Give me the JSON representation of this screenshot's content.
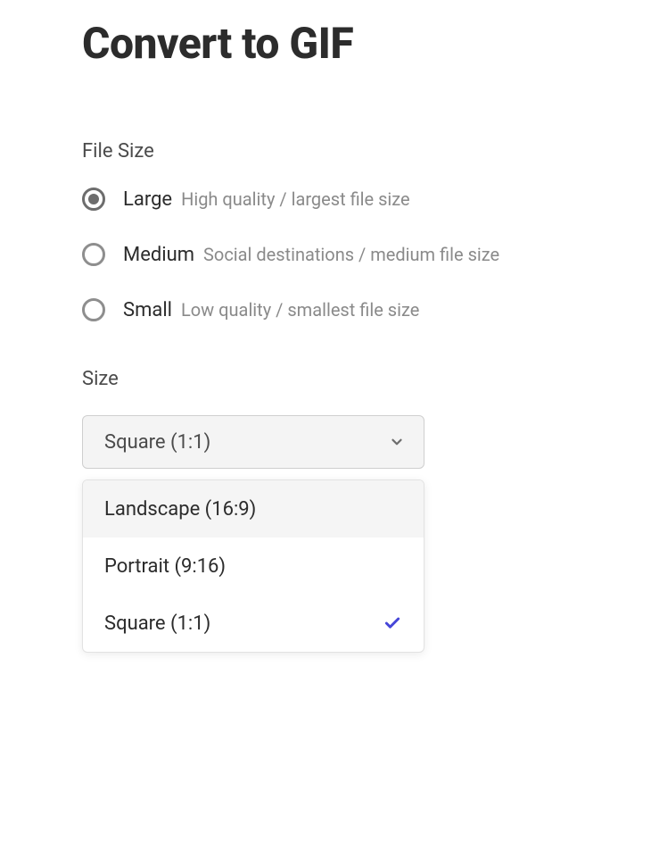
{
  "title": "Convert to GIF",
  "file_size_section": {
    "label": "File Size",
    "options": [
      {
        "label": "Large",
        "description": "High quality / largest file size",
        "selected": true
      },
      {
        "label": "Medium",
        "description": "Social destinations / medium file size",
        "selected": false
      },
      {
        "label": "Small",
        "description": "Low quality / smallest file size",
        "selected": false
      }
    ]
  },
  "size_section": {
    "label": "Size",
    "selected_value": "Square (1:1)",
    "options": [
      {
        "label": "Landscape (16:9)",
        "hovered": true,
        "selected": false
      },
      {
        "label": "Portrait (9:16)",
        "hovered": false,
        "selected": false
      },
      {
        "label": "Square (1:1)",
        "hovered": false,
        "selected": true
      }
    ]
  },
  "colors": {
    "check": "#4646d8",
    "chevron": "#6d6d6d"
  }
}
